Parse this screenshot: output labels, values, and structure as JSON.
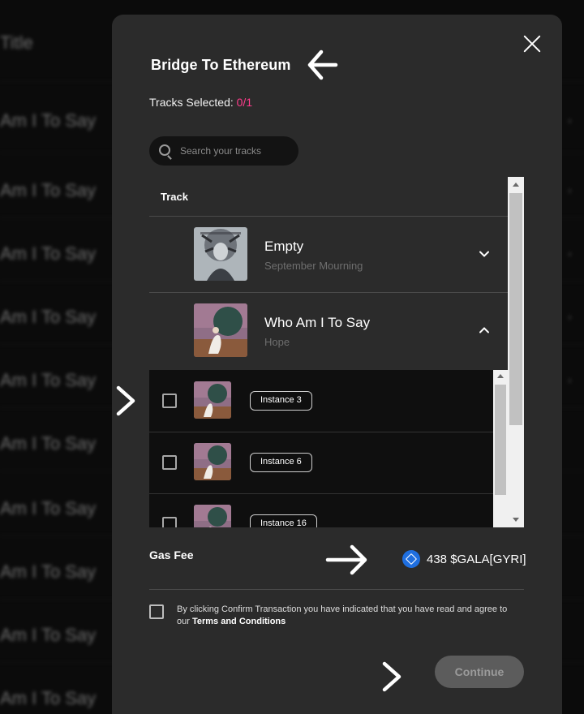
{
  "background": {
    "header_text": "Title",
    "rows": [
      "Am I To Say",
      "Am I To Say",
      "Am I To Say",
      "Am I To Say",
      "Am I To Say",
      "Am I To Say",
      "Am I To Say",
      "Am I To Say",
      "Am I To Say",
      "Am I To Say"
    ]
  },
  "modal": {
    "title": "Bridge To Ethereum",
    "selected_label": "Tracks Selected:",
    "selected_count": "0/1",
    "search": {
      "placeholder": "Search your tracks",
      "value": ""
    },
    "table_header": "Track",
    "tracks": [
      {
        "name": "Empty",
        "artist": "September Mourning",
        "expanded": false
      },
      {
        "name": "Who Am I To Say",
        "artist": "Hope",
        "expanded": true
      }
    ],
    "instances": [
      {
        "label": "Instance 3",
        "checked": false
      },
      {
        "label": "Instance 6",
        "checked": false
      },
      {
        "label": "Instance 16",
        "checked": false
      }
    ],
    "gas_fee_label": "Gas Fee",
    "gas_fee_value": "438 $GALA[GYRI]",
    "terms_text": "By clicking Confirm Transaction you have indicated that you have read and agree to our",
    "terms_link": "Terms and Conditions",
    "terms_checked": false,
    "continue_label": "Continue"
  },
  "colors": {
    "accent_pink": "#ff3c8c",
    "gala_blue": "#1f6fe0",
    "modal_bg": "#2b2b2b"
  },
  "icons": [
    "close-icon",
    "search-icon",
    "chevron-down-icon",
    "chevron-up-icon",
    "gala-token-icon",
    "annotation-arrow-icon"
  ]
}
